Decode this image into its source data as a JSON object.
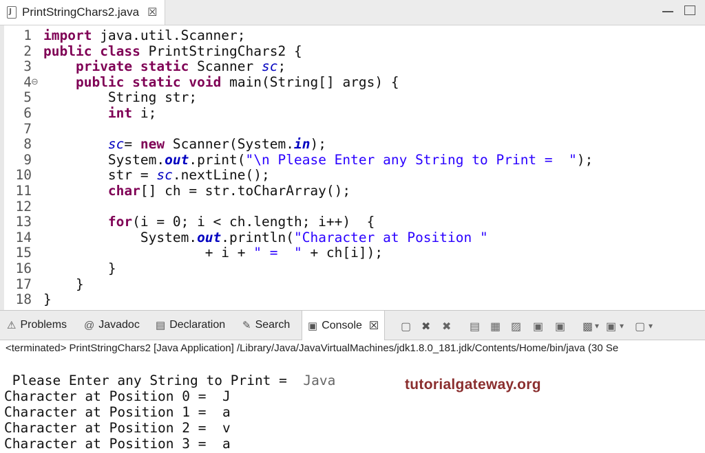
{
  "editor": {
    "tab_title": "PrintStringChars2.java",
    "close_glyph": "☒",
    "lines": [
      {
        "n": "1",
        "html": "<span class=\"kw\">import</span> java.util.Scanner;"
      },
      {
        "n": "2",
        "html": "<span class=\"kw\">public</span> <span class=\"kw\">class</span> PrintStringChars2 {"
      },
      {
        "n": "3",
        "html": "    <span class=\"kw\">private</span> <span class=\"kw\">static</span> Scanner <span class=\"fld\">sc</span>;"
      },
      {
        "n": "4",
        "fold": "⊖",
        "html": "    <span class=\"kw\">public</span> <span class=\"kw\">static</span> <span class=\"kw\">void</span> main(String[] args) {"
      },
      {
        "n": "5",
        "html": "        String str;"
      },
      {
        "n": "6",
        "html": "        <span class=\"kw\">int</span> i;"
      },
      {
        "n": "7",
        "html": ""
      },
      {
        "n": "8",
        "html": "        <span class=\"fld\">sc</span>= <span class=\"kw\">new</span> Scanner(System.<span class=\"sfld\">in</span>);"
      },
      {
        "n": "9",
        "html": "        System.<span class=\"sfld\">out</span>.print(<span class=\"str\">\"\\n Please Enter any String to Print =  \"</span>);"
      },
      {
        "n": "10",
        "html": "        str = <span class=\"fld\">sc</span>.nextLine();"
      },
      {
        "n": "11",
        "html": "        <span class=\"kw\">char</span>[] ch = str.toCharArray();"
      },
      {
        "n": "12",
        "html": ""
      },
      {
        "n": "13",
        "html": "        <span class=\"kw\">for</span>(i = 0; i &lt; ch.length; i++)  {"
      },
      {
        "n": "14",
        "html": "            System.<span class=\"sfld\">out</span>.println(<span class=\"str\">\"Character at Position \"</span>"
      },
      {
        "n": "15",
        "html": "                    + i + <span class=\"str\">\" =  \"</span> + ch[i]);"
      },
      {
        "n": "16",
        "html": "        }"
      },
      {
        "n": "17",
        "html": "    }"
      },
      {
        "n": "18",
        "html": "}"
      }
    ]
  },
  "views": {
    "tabs": [
      {
        "label": "Problems",
        "icon": "problems-icon",
        "glyph": "⚠"
      },
      {
        "label": "Javadoc",
        "icon": "javadoc-icon",
        "glyph": "@"
      },
      {
        "label": "Declaration",
        "icon": "declaration-icon",
        "glyph": "▤"
      },
      {
        "label": "Search",
        "icon": "search-icon",
        "glyph": "✎"
      },
      {
        "label": "Console",
        "icon": "console-icon",
        "glyph": "▣"
      }
    ],
    "console_close_glyph": "☒",
    "toolbar_glyphs": [
      "▢",
      "✖",
      "✖",
      "▤",
      "▦",
      "▨",
      "▣",
      "▣",
      "▩",
      "▾",
      "▣",
      "▾",
      "▢",
      "▾"
    ]
  },
  "console": {
    "header": "<terminated> PrintStringChars2 [Java Application] /Library/Java/JavaVirtualMachines/jdk1.8.0_181.jdk/Contents/Home/bin/java  (30 Se",
    "prompt": " Please Enter any String to Print =  ",
    "input": "Java",
    "outputs": [
      "Character at Position 0 =  J",
      "Character at Position 1 =  a",
      "Character at Position 2 =  v",
      "Character at Position 3 =  a"
    ]
  },
  "watermark": "tutorialgateway.org"
}
